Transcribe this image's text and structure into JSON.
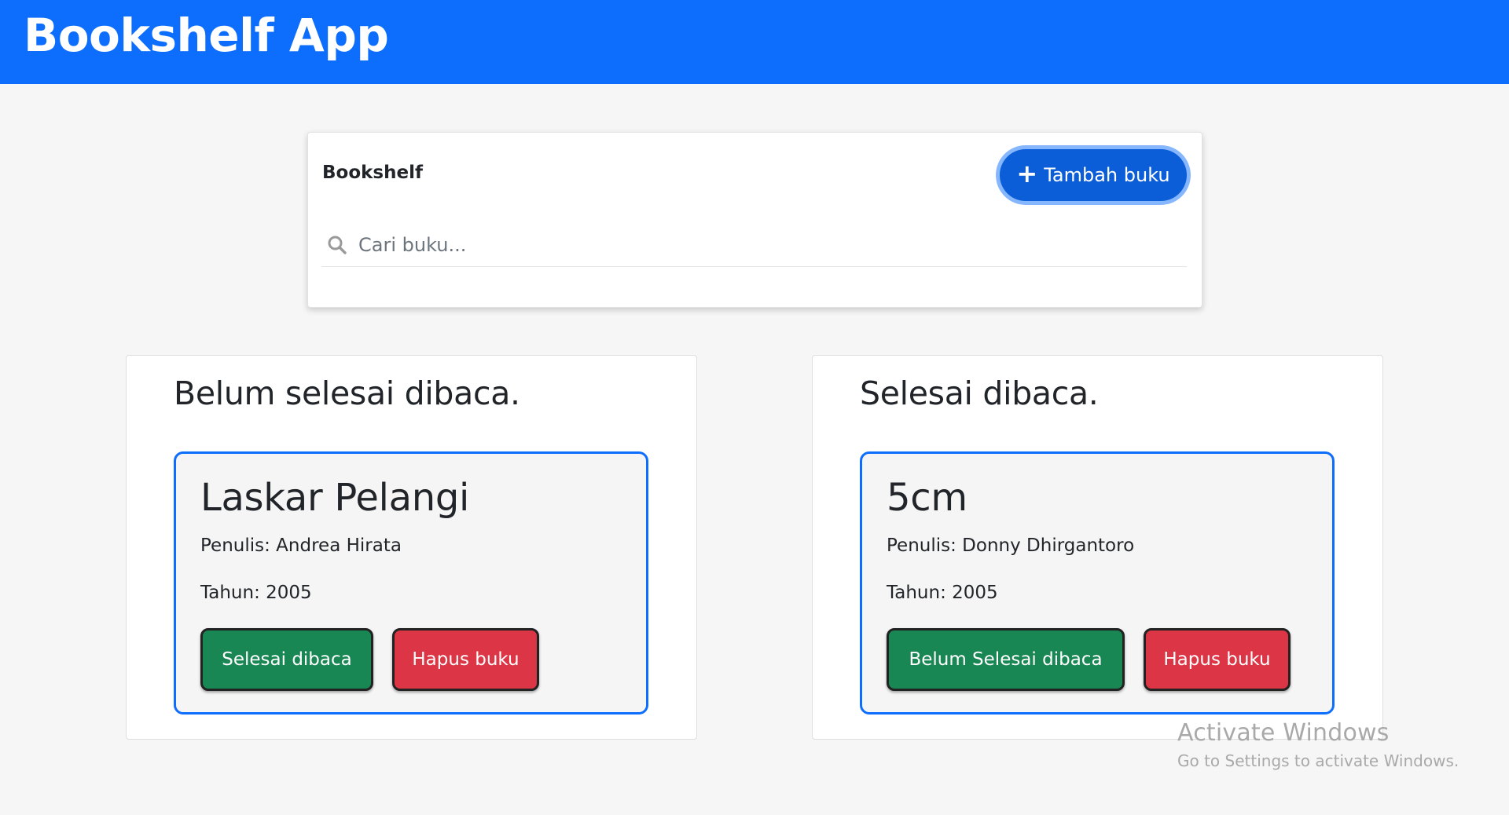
{
  "header": {
    "title": "Bookshelf App"
  },
  "search_panel": {
    "title": "Bookshelf",
    "add_button_label": "Tambah buku",
    "search_placeholder": "Cari buku..."
  },
  "shelves": [
    {
      "heading": "Belum selesai dibaca.",
      "books": [
        {
          "title": "Laskar Pelangi",
          "author": "Penulis: Andrea Hirata",
          "year": "Tahun: 2005",
          "toggle_label": "Selesai dibaca",
          "delete_label": "Hapus buku"
        }
      ]
    },
    {
      "heading": "Selesai dibaca.",
      "books": [
        {
          "title": "5cm",
          "author": "Penulis: Donny Dhirgantoro",
          "year": "Tahun: 2005",
          "toggle_label": "Belum Selesai dibaca",
          "delete_label": "Hapus buku"
        }
      ]
    }
  ],
  "watermark": {
    "title": "Activate Windows",
    "subtitle": "Go to Settings to activate Windows."
  },
  "colors": {
    "primary": "#0d6efd",
    "success": "#198754",
    "danger": "#dc3545",
    "background": "#f6f6f6"
  },
  "icons": {
    "add": "plus-icon",
    "search": "search-icon"
  }
}
